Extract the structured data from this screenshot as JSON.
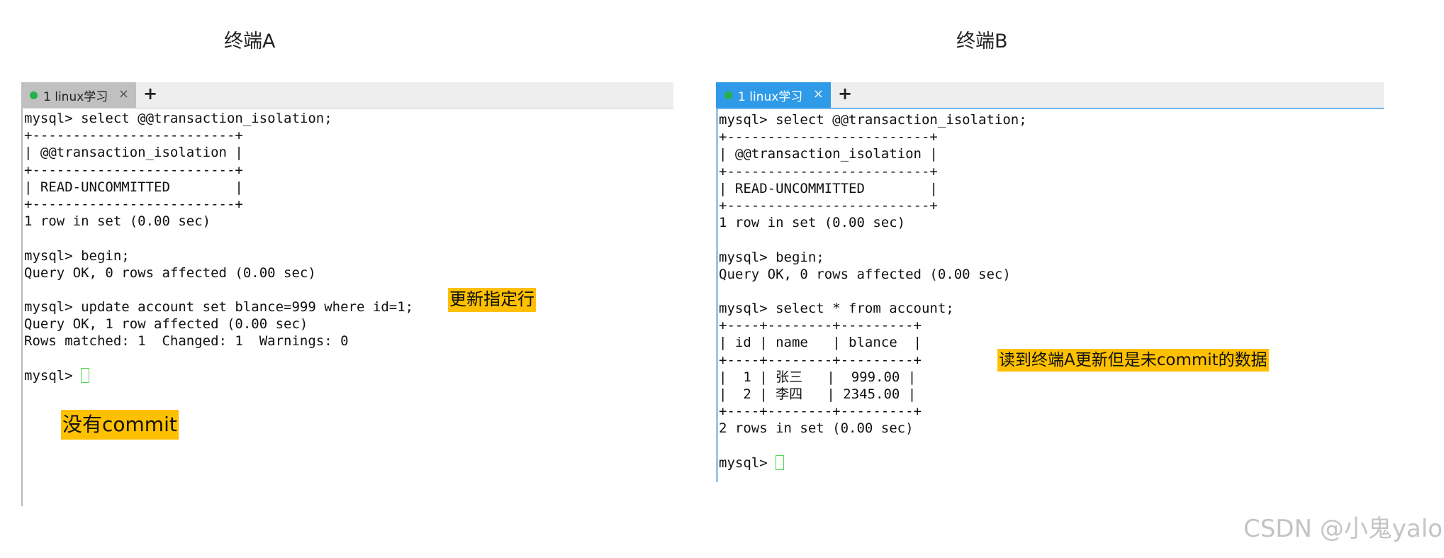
{
  "captions": {
    "a": "终端A",
    "b": "终端B"
  },
  "terminal_a": {
    "tab_label": "1 linux学习",
    "tab_close": "×",
    "tab_add": "+",
    "lines": [
      "mysql> select @@transaction_isolation;",
      "+-------------------------+",
      "| @@transaction_isolation |",
      "+-------------------------+",
      "| READ-UNCOMMITTED        |",
      "+-------------------------+",
      "1 row in set (0.00 sec)",
      "",
      "mysql> begin;",
      "Query OK, 0 rows affected (0.00 sec)",
      "",
      "mysql> update account set blance=999 where id=1;",
      "Query OK, 1 row affected (0.00 sec)",
      "Rows matched: 1  Changed: 1  Warnings: 0",
      "",
      "mysql> "
    ],
    "notes": {
      "update_row": "更新指定行",
      "no_commit": "没有commit"
    }
  },
  "terminal_b": {
    "tab_label": "1 linux学习",
    "tab_close": "×",
    "tab_add": "+",
    "lines": [
      "mysql> select @@transaction_isolation;",
      "+-------------------------+",
      "| @@transaction_isolation |",
      "+-------------------------+",
      "| READ-UNCOMMITTED        |",
      "+-------------------------+",
      "1 row in set (0.00 sec)",
      "",
      "mysql> begin;",
      "Query OK, 0 rows affected (0.00 sec)",
      "",
      "mysql> select * from account;",
      "+----+--------+---------+",
      "| id | name   | blance  |",
      "+----+--------+---------+",
      "|  1 | 张三   |  999.00 |",
      "|  2 | 李四   | 2345.00 |",
      "+----+--------+---------+",
      "2 rows in set (0.00 sec)",
      "",
      "mysql> "
    ],
    "notes": {
      "read_uncommitted": "读到终端A更新但是未commit的数据"
    }
  },
  "watermark": "CSDN @小鬼yalo",
  "colors": {
    "tab_active_a": "#c0c0c0",
    "tab_active_b": "#2f9be8",
    "note_bg": "#ffc000",
    "cursor": "#4fd64f",
    "status_dot": "#23b24a"
  }
}
